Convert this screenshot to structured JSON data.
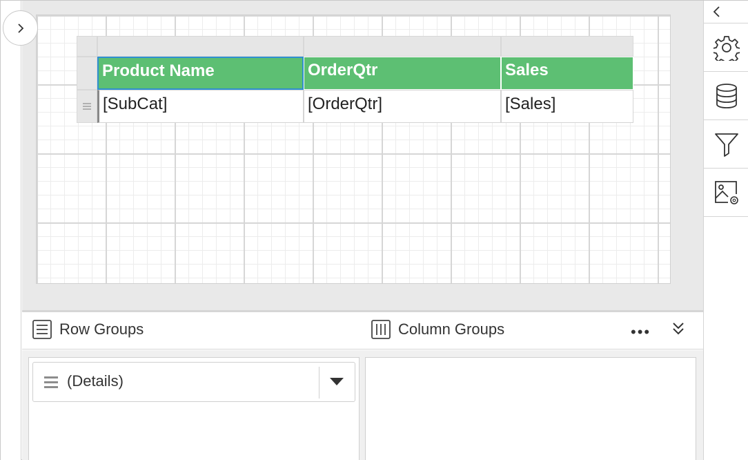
{
  "table": {
    "headers": [
      "Product Name",
      "OrderQtr",
      "Sales"
    ],
    "cells": [
      "[SubCat]",
      "[OrderQtr]",
      "[Sales]"
    ]
  },
  "groups": {
    "row_groups_label": "Row Groups",
    "column_groups_label": "Column Groups",
    "more_label": "•••",
    "row_items": [
      {
        "label": "(Details)"
      }
    ]
  },
  "colors": {
    "header_fill": "#5dbf73",
    "selection_border": "#2f8fd0",
    "canvas_bg": "#e9e9e9"
  },
  "icons": {
    "expand": "chevron-right-icon",
    "collapse_panel": "chevron-left-icon",
    "properties": "gear-icon",
    "data": "database-icon",
    "filter": "filter-icon",
    "image_settings": "image-settings-icon",
    "row_groups": "list-icon",
    "column_groups": "columns-icon",
    "collapse_groups": "double-chevron-down-icon"
  }
}
